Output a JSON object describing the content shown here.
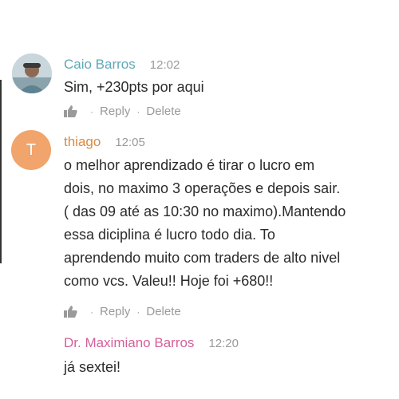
{
  "comments": [
    {
      "author": "Caio Barros",
      "author_color": "#5fa8b5",
      "time": "12:02",
      "text": "Sim, +230pts por aqui",
      "avatar_icon": "user-photo",
      "actions": {
        "reply": "Reply",
        "delete": "Delete",
        "separator": "·"
      }
    },
    {
      "author": "thiago",
      "author_color": "#d98a3e",
      "time": "12:05",
      "avatar_letter": "T",
      "avatar_color": "#f1a46b",
      "lines": [
        "o melhor aprendizado é tirar o lucro em",
        "dois, no maximo 3 operações e depois sair.",
        "( das 09 até as 10:30 no maximo).Mantendo",
        "essa diciplina é lucro todo dia. To",
        "aprendendo muito com traders de alto nivel",
        "como vcs. Valeu!! Hoje foi +680!!"
      ],
      "actions": {
        "reply": "Reply",
        "delete": "Delete",
        "separator": "·"
      }
    },
    {
      "author": "Dr. Maximiano Barros",
      "author_color": "#d4609a",
      "time": "12:20",
      "text": "já sextei!"
    }
  ]
}
